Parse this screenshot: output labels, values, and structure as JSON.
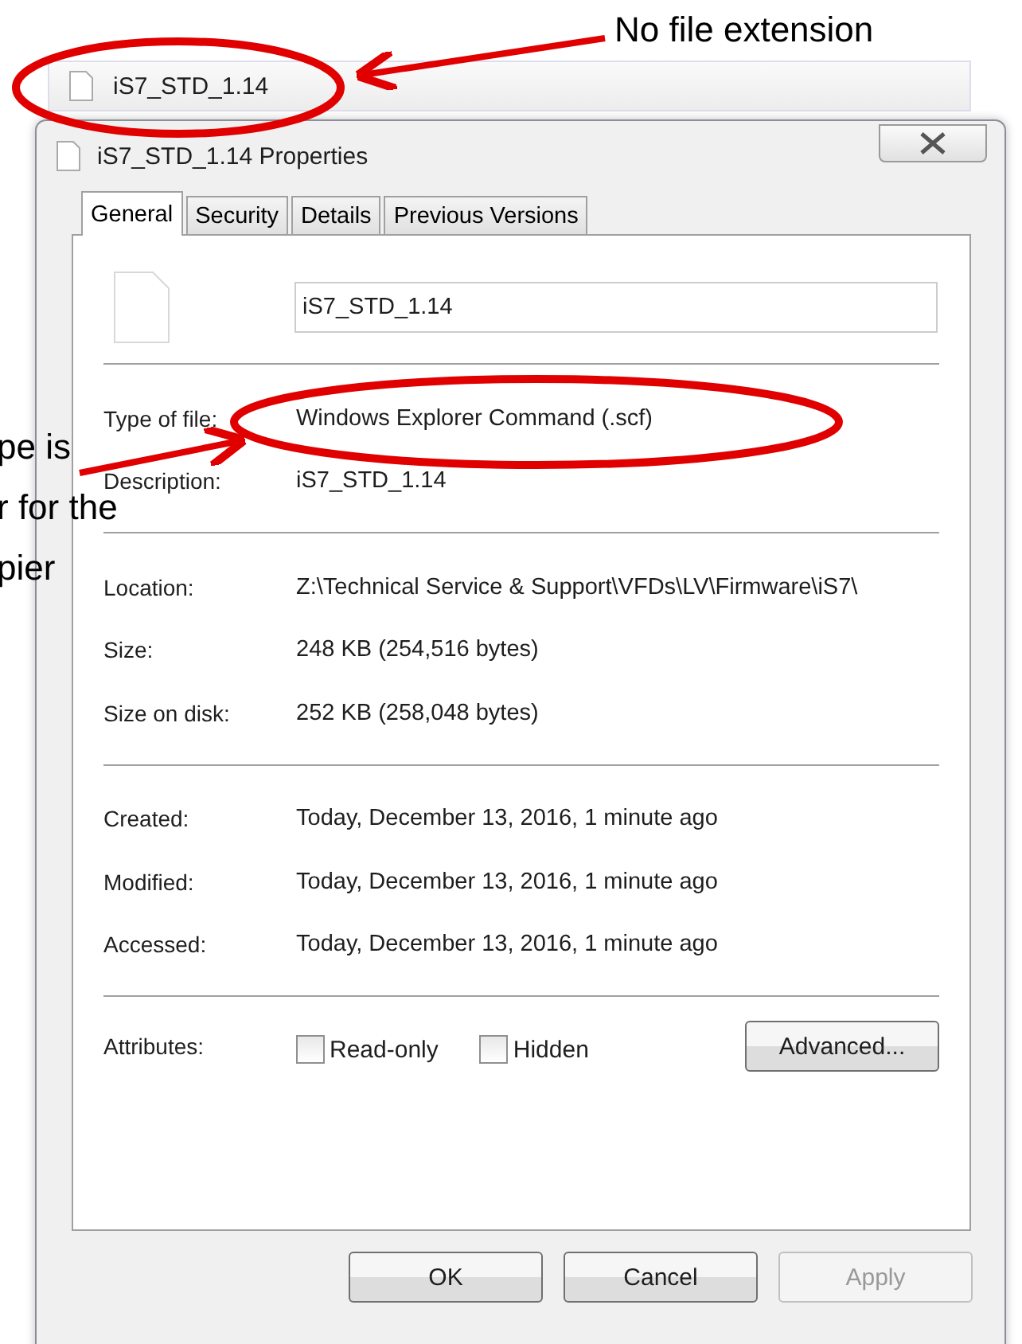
{
  "callouts": [
    {
      "lines": [
        "No file extension"
      ]
    },
    {
      "lines": [
        "pe is",
        "r for the",
        "pier"
      ]
    }
  ],
  "explorer_item": {
    "name": "iS7_STD_1.14"
  },
  "dialog": {
    "title": "iS7_STD_1.14 Properties",
    "tabs": [
      {
        "label": "General",
        "selected": true
      },
      {
        "label": "Security",
        "selected": false
      },
      {
        "label": "Details",
        "selected": false
      },
      {
        "label": "Previous Versions",
        "selected": false
      }
    ],
    "file_name": "iS7_STD_1.14",
    "groups": [
      [
        {
          "label": "Type of file:",
          "value": "Windows Explorer Command (.scf)"
        },
        {
          "label": "Description:",
          "value": "iS7_STD_1.14"
        }
      ],
      [
        {
          "label": "Location:",
          "value": "Z:\\Technical Service & Support\\VFDs\\LV\\Firmware\\iS7\\"
        },
        {
          "label": "Size:",
          "value": "248 KB (254,516 bytes)"
        },
        {
          "label": "Size on disk:",
          "value": "252 KB (258,048 bytes)"
        }
      ],
      [
        {
          "label": "Created:",
          "value": "Today, December 13, 2016, 1 minute ago"
        },
        {
          "label": "Modified:",
          "value": "Today, December 13, 2016, 1 minute ago"
        },
        {
          "label": "Accessed:",
          "value": "Today, December 13, 2016, 1 minute ago"
        }
      ]
    ],
    "attributes": {
      "label": "Attributes:",
      "checkboxes": [
        {
          "label": "Read-only",
          "checked": false
        },
        {
          "label": "Hidden",
          "checked": false
        }
      ],
      "button": "Advanced..."
    },
    "buttons": [
      {
        "label": "OK",
        "disabled": false
      },
      {
        "label": "Cancel",
        "disabled": false
      },
      {
        "label": "Apply",
        "disabled": true
      }
    ]
  }
}
